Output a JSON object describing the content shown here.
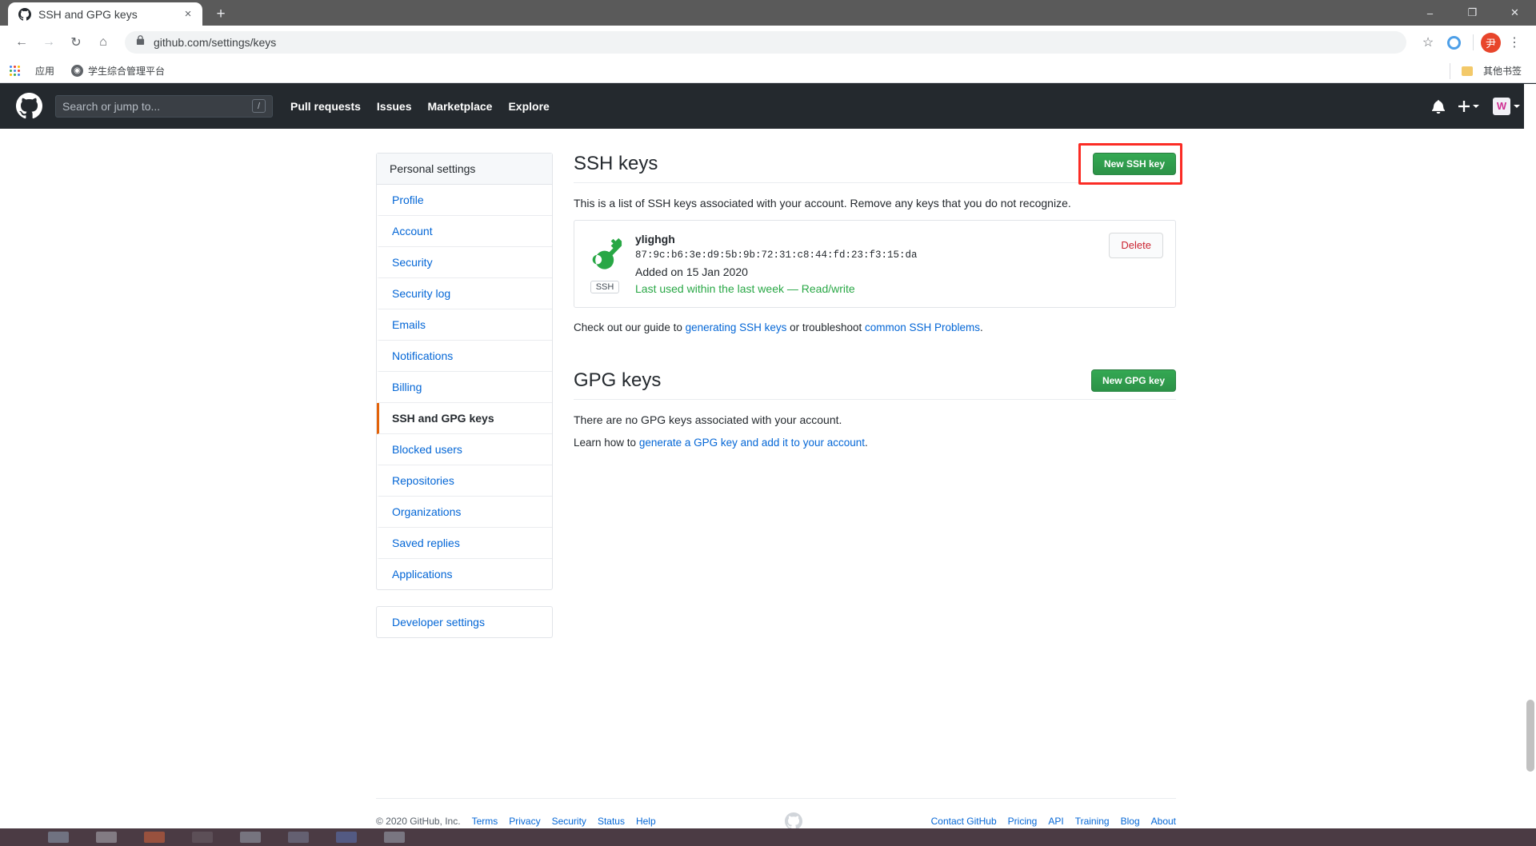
{
  "browser": {
    "tab": {
      "title": "SSH and GPG keys",
      "favicon": "github-mark-icon",
      "close": "×"
    },
    "new_tab_label": "+",
    "window_controls": {
      "minimize": "–",
      "maximize": "❐",
      "close": "✕"
    },
    "nav": {
      "back": "←",
      "forward": "→",
      "reload": "↻",
      "home": "⌂"
    },
    "omnibox": {
      "url": "github.com/settings/keys",
      "lock_icon": "lock-icon"
    },
    "toolbar_right": {
      "star": "☆",
      "extension": "extension-circle-icon",
      "profile_initial": "尹",
      "menu": "⋮"
    },
    "bookmarks": {
      "apps_label": "应用",
      "items": [
        {
          "label": "学生综合管理平台",
          "icon": "globe-icon"
        }
      ],
      "other_label": "其他书签"
    }
  },
  "gh_header": {
    "logo": "github-mark-icon",
    "search_placeholder": "Search or jump to...",
    "search_value": "",
    "slash_hint": "/",
    "nav": [
      {
        "label": "Pull requests"
      },
      {
        "label": "Issues"
      },
      {
        "label": "Marketplace"
      },
      {
        "label": "Explore"
      }
    ],
    "notifications_icon": "bell-icon",
    "create_new_icon": "plus-icon",
    "avatar_initial": "W"
  },
  "sidebar": {
    "header": "Personal settings",
    "items": [
      {
        "label": "Profile",
        "active": false
      },
      {
        "label": "Account",
        "active": false
      },
      {
        "label": "Security",
        "active": false
      },
      {
        "label": "Security log",
        "active": false
      },
      {
        "label": "Emails",
        "active": false
      },
      {
        "label": "Notifications",
        "active": false
      },
      {
        "label": "Billing",
        "active": false
      },
      {
        "label": "SSH and GPG keys",
        "active": true
      },
      {
        "label": "Blocked users",
        "active": false
      },
      {
        "label": "Repositories",
        "active": false
      },
      {
        "label": "Organizations",
        "active": false
      },
      {
        "label": "Saved replies",
        "active": false
      },
      {
        "label": "Applications",
        "active": false
      }
    ],
    "developer_settings": "Developer settings"
  },
  "ssh_section": {
    "title": "SSH keys",
    "new_key_button": "New SSH key",
    "description": "This is a list of SSH keys associated with your account. Remove any keys that you do not recognize.",
    "keys": [
      {
        "name": "ylighgh",
        "fingerprint": "87:9c:b6:3e:d9:5b:9b:72:31:c8:44:fd:23:f3:15:da",
        "added": "Added on 15 Jan 2020",
        "last_used": "Last used within the last week — Read/write",
        "badge": "SSH",
        "delete_label": "Delete",
        "key_icon": "key-icon"
      }
    ],
    "guide_prefix": "Check out our guide to ",
    "guide_link1": "generating SSH keys",
    "guide_middle": " or troubleshoot ",
    "guide_link2": "common SSH Problems",
    "guide_suffix": "."
  },
  "gpg_section": {
    "title": "GPG keys",
    "new_key_button": "New GPG key",
    "empty_message": "There are no GPG keys associated with your account.",
    "learn_prefix": "Learn how to ",
    "learn_link": "generate a GPG key and add it to your account",
    "learn_suffix": "."
  },
  "footer": {
    "copyright": "© 2020 GitHub, Inc.",
    "left_links": [
      "Terms",
      "Privacy",
      "Security",
      "Status",
      "Help"
    ],
    "mark": "github-mark-icon",
    "right_links": [
      "Contact GitHub",
      "Pricing",
      "API",
      "Training",
      "Blog",
      "About"
    ]
  },
  "annotation": {
    "target": "new-ssh-key-button",
    "color": "#fb2c25"
  }
}
